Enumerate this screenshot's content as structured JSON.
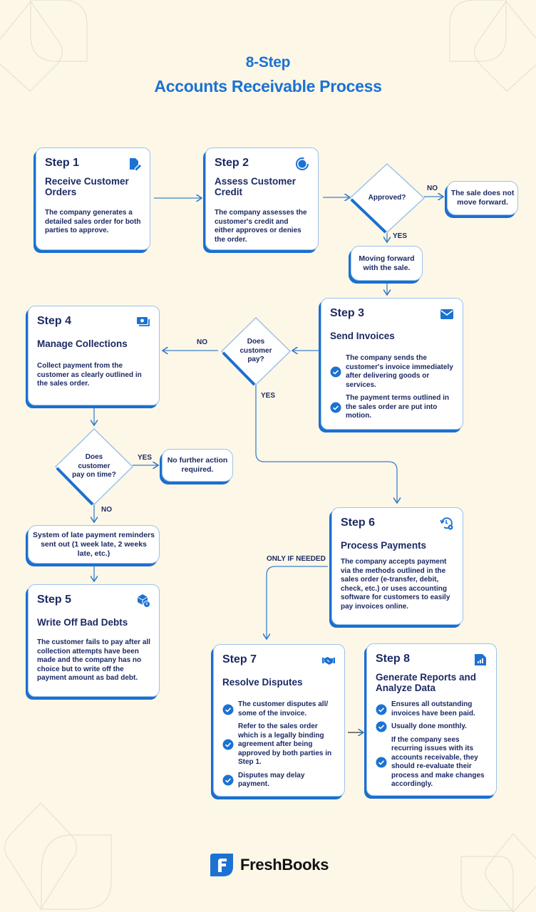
{
  "title": {
    "line1": "8-Step",
    "line2": "Accounts Receivable Process"
  },
  "colors": {
    "accent": "#1b72d3",
    "text": "#1c2a63",
    "background": "#fdf7e7",
    "card_border": "#9cc2ea"
  },
  "steps": [
    {
      "step": "Step 1",
      "heading": "Receive Customer Orders",
      "icon": "document-edit-icon",
      "description": "The company generates a detailed sales order for both parties to approve."
    },
    {
      "step": "Step 2",
      "heading": "Assess Customer Credit",
      "icon": "credit-gauge-icon",
      "description": "The company assesses the customer's credit and either approves or denies the order."
    },
    {
      "step": "Step 3",
      "heading": "Send Invoices",
      "icon": "envelope-icon",
      "bullets": [
        "The company sends the customer's invoice immediately after delivering goods or services.",
        "The payment terms outlined in the sales order are put into motion."
      ]
    },
    {
      "step": "Step 4",
      "heading": "Manage Collections",
      "icon": "cash-icon",
      "description": "Collect payment from the customer as clearly outlined in the sales order."
    },
    {
      "step": "Step 5",
      "heading": "Write Off Bad Debts",
      "icon": "box-alert-icon",
      "description": "The customer fails to pay after all collection attempts have been made and the company has no choice but to write off the payment amount as bad debt."
    },
    {
      "step": "Step 6",
      "heading": "Process Payments",
      "icon": "history-gear-icon",
      "description": "The company accepts payment via the methods outlined in the sales order (e-transfer, debit, check, etc.) or uses accounting software for customers to easily pay invoices online."
    },
    {
      "step": "Step 7",
      "heading": "Resolve Disputes",
      "icon": "handshake-icon",
      "bullets": [
        "The customer disputes all/ some of the invoice.",
        "Refer to the sales order which is a legally binding agreement after being approved by both parties in Step 1.",
        "Disputes may delay payment."
      ]
    },
    {
      "step": "Step 8",
      "heading": "Generate Reports and Analyze Data",
      "icon": "bar-chart-icon",
      "bullets": [
        "Ensures all outstanding invoices have been paid.",
        "Usually done monthly.",
        "If the company sees recurring issues with its accounts receivable, they should re-evaluate their process and make changes accordingly."
      ]
    }
  ],
  "decisions": {
    "approved": "Approved?",
    "customer_pay": "Does customer pay?",
    "pay_on_time": "Does customer pay on time?"
  },
  "outcomes": {
    "sale_not_forward": "The sale does not move forward.",
    "moving_forward": "Moving forward with the sale.",
    "no_further_action": "No further action required.",
    "late_reminders": "System of late payment reminders sent out (1 week late, 2 weeks late, etc.)"
  },
  "labels": {
    "no": "NO",
    "yes": "YES",
    "only_if_needed": "ONLY IF NEEDED"
  },
  "brand": {
    "name": "FreshBooks",
    "logo_icon": "freshbooks-logo-icon"
  }
}
